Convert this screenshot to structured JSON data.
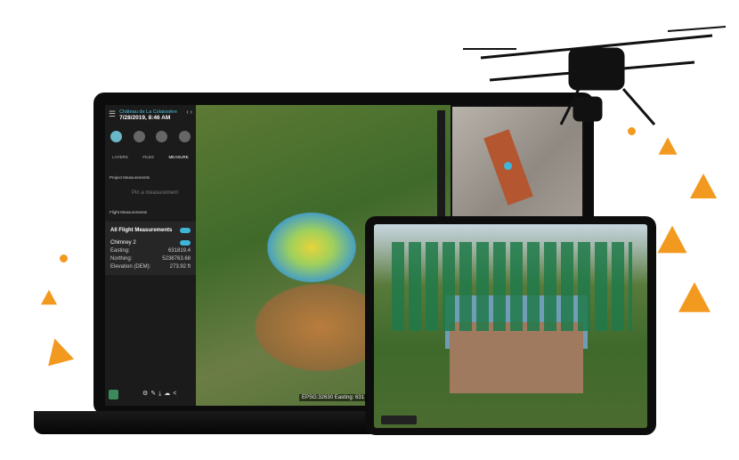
{
  "project": {
    "title": "Château de La Colaissière",
    "date": "7/28/2019, 8:46 AM"
  },
  "tabs": [
    "LAYERS",
    "FILES",
    "MEASURE"
  ],
  "sections": {
    "project_measurements": "Project Measurements",
    "pin_placeholder": "Pin a measurement",
    "flight_measurements": "Flight Measurements",
    "all_flight": "All Flight Measurements"
  },
  "measurement": {
    "name": "Chimney 2",
    "rows": [
      {
        "label": "Easting:",
        "value": "631819.4"
      },
      {
        "label": "Northing:",
        "value": "5238763.68"
      },
      {
        "label": "Elevation (DEM):",
        "value": "273.92 ft"
      }
    ]
  },
  "status_bar": "EPSG:32630 Easting: 631",
  "colors": {
    "accent": "#3fb6d8",
    "orange": "#f29a1f"
  }
}
